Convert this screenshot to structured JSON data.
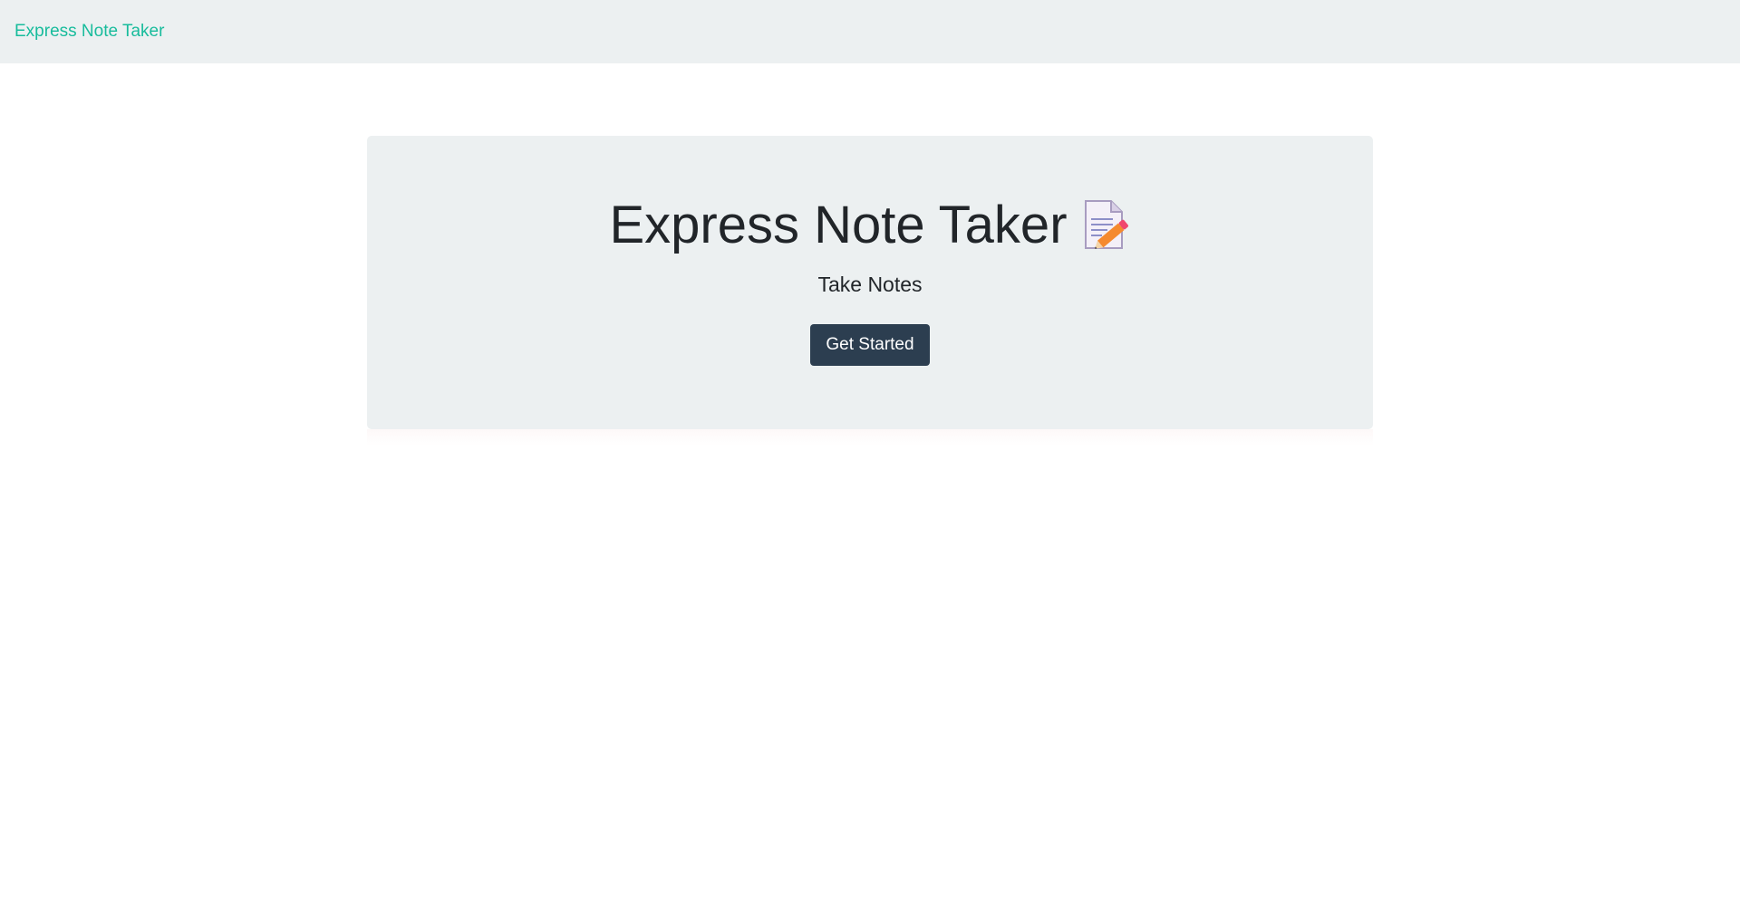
{
  "navbar": {
    "brand_label": "Express Note Taker"
  },
  "jumbotron": {
    "title": "Express Note Taker",
    "icon": "memo-icon",
    "subtitle": "Take Notes",
    "cta_label": "Get Started"
  },
  "colors": {
    "navbar_bg": "#ecf0f1",
    "brand": "#18bc9c",
    "button_bg": "#2c3e50",
    "text": "#212529"
  }
}
